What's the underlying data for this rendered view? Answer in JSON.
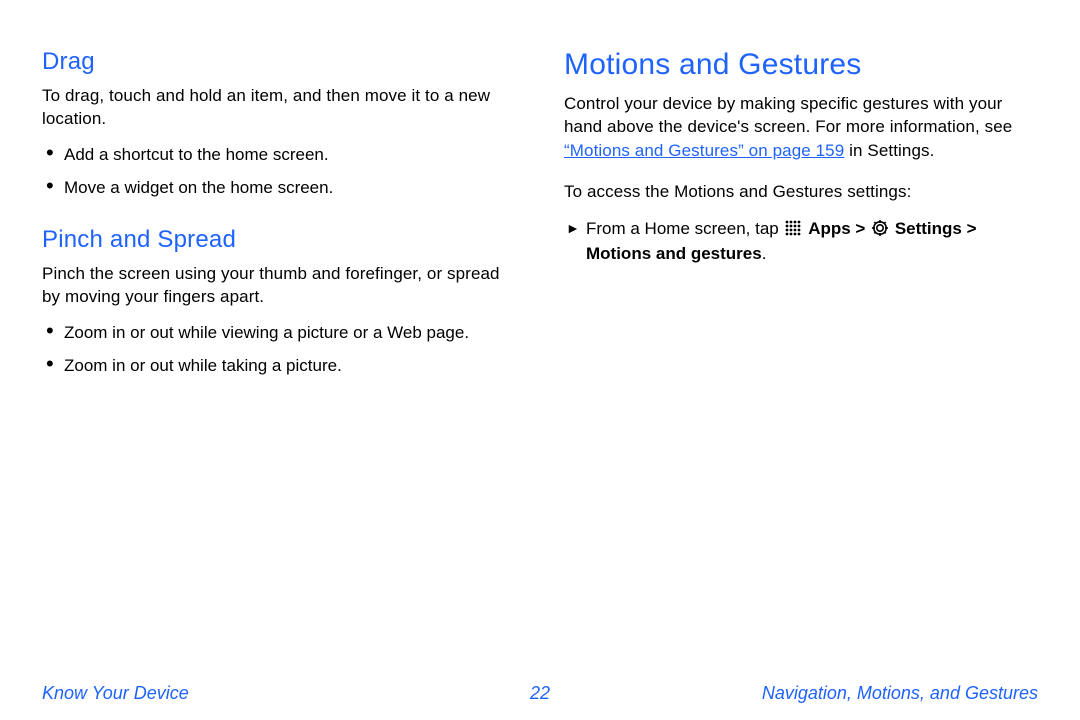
{
  "left": {
    "drag": {
      "title": "Drag",
      "desc": "To drag, touch and hold an item, and then move it to a new location.",
      "bullets": [
        "Add a shortcut to the home screen.",
        "Move a widget on the home screen."
      ]
    },
    "pinch": {
      "title": "Pinch and Spread",
      "desc": "Pinch the screen using your thumb and forefinger, or spread by moving your fingers apart.",
      "bullets": [
        "Zoom in or out while viewing a picture or a Web page.",
        "Zoom in or out while taking a picture."
      ]
    }
  },
  "right": {
    "title": "Motions and Gestures",
    "intro_pre": "Control your device by making specific gestures with your hand above the device's screen. For more information, see ",
    "intro_link": "“Motions and Gestures” on page 159",
    "intro_post": " in Settings.",
    "access": "To access the Motions and Gestures settings:",
    "step_pre": "From a Home screen, tap ",
    "apps": "Apps",
    "gt1": " > ",
    "settings": "Settings",
    "gt2": " > ",
    "motions": "Motions and gestures",
    "period": "."
  },
  "footer": {
    "left": "Know Your Device",
    "page": "22",
    "right": "Navigation, Motions, and Gestures"
  }
}
